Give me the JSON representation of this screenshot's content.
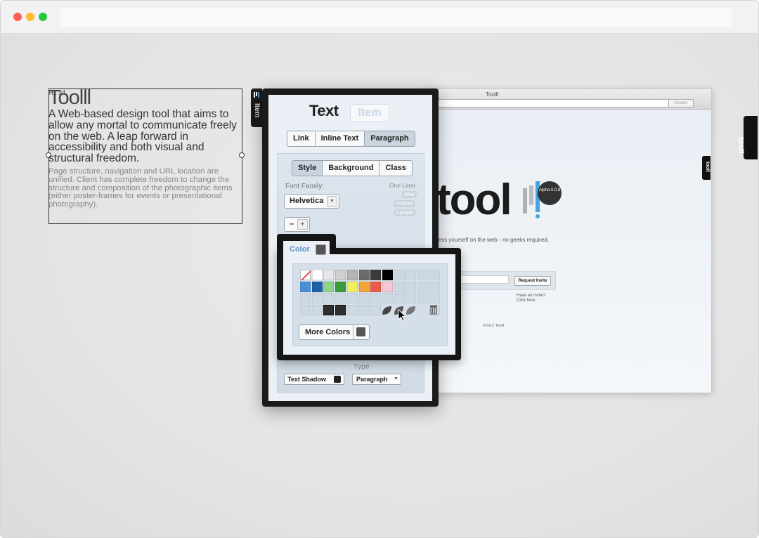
{
  "window": {
    "title_controls": [
      "close",
      "minimize",
      "zoom"
    ],
    "colors": {
      "close": "#ff5f57",
      "minimize": "#febc2e",
      "zoom": "#28c840"
    }
  },
  "selected_block": {
    "tag": "H1 34",
    "title": "Toolll",
    "lead": "A Web-based design tool that aims to allow any mortal to communicate freely on the web. A leap forward in accessibility and both visual and structural freedom.",
    "body": "Page structure, navigation and URL location are unified. Client has complete freedom to change the structure and composition of the photographic items (either poster-frames for events or presentational photography)."
  },
  "preview": {
    "window_title": "Toolll",
    "reader_label": "Reader",
    "logo_text": "tool",
    "alpha_badge": "Alpha 0.0.8",
    "tagline": "ress yourself on the web - no geeks required.",
    "email_placeholder": "address",
    "request_button": "Request Invite",
    "invite_line1": "Have an invite?",
    "invite_line2": "Click here",
    "copyright": "©2012 Toolll"
  },
  "edge_tabs": {
    "big": "tooll",
    "small": "tooll"
  },
  "inspector": {
    "side_tab": "Item",
    "title": "Text",
    "title_alt": "Item",
    "type_tabs": [
      "Link",
      "Inline Text",
      "Paragraph"
    ],
    "type_tab_active": "Paragraph",
    "style_tabs": [
      "Style",
      "Background",
      "Class"
    ],
    "style_tab_active": "Style",
    "font_family_label": "Font Family:",
    "font_family_value": "Helvetica",
    "size_value": "–",
    "one_liner_label": "One Liner",
    "one_liner_actions": [
      "new",
      "restore",
      "update"
    ],
    "type_label": "Type",
    "text_shadow_button": "Text Shadow",
    "type_value": "Paragraph"
  },
  "color_popover": {
    "tab_label": "Color",
    "more_colors_button": "More Colors",
    "accent": "#5c8fc4",
    "rows": [
      [
        "none",
        "#ffffff",
        "#e6e6e6",
        "#cfcfcf",
        "#b3b3b3",
        "#6b6b6b",
        "#3a3a3a",
        "#000000",
        "",
        "",
        "",
        ""
      ],
      [
        "#4a90d9",
        "#1e5fa8",
        "#8fd48a",
        "#3c9a3c",
        "#f3f058",
        "#f5a53a",
        "#ee5a4a",
        "#f5c6d6",
        "",
        "",
        "",
        ""
      ],
      [
        "",
        "",
        "",
        "",
        "",
        "",
        "",
        "",
        "",
        "",
        "",
        ""
      ]
    ],
    "saved_swatches": [
      "#2f2f2f",
      "#2f2f2f"
    ]
  }
}
